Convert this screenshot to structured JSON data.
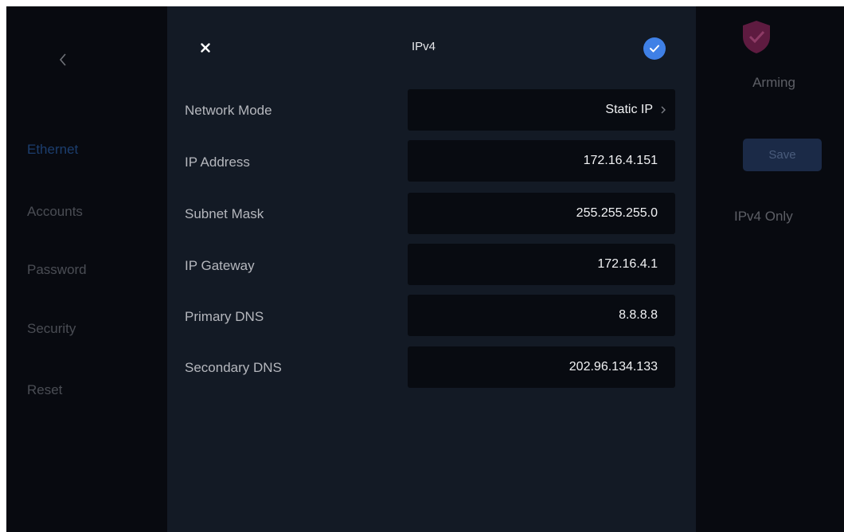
{
  "nav": {
    "items": [
      {
        "label": "Ethernet",
        "active": true
      },
      {
        "label": "Accounts"
      },
      {
        "label": "Password"
      },
      {
        "label": "Security"
      },
      {
        "label": "Reset"
      }
    ]
  },
  "right": {
    "arming_label": "Arming",
    "save_label": "Save",
    "mode_label": "IPv4 Only",
    "arming_color": "#6b1f47"
  },
  "dialog": {
    "title": "IPv4",
    "accent": "#3f80e6",
    "rows": [
      {
        "label": "Network Mode",
        "value": "Static IP",
        "has_arrow": true
      },
      {
        "label": "IP Address",
        "value": "172.16.4.151"
      },
      {
        "label": "Subnet Mask",
        "value": "255.255.255.0"
      },
      {
        "label": "IP Gateway",
        "value": "172.16.4.1"
      },
      {
        "label": "Primary DNS",
        "value": "8.8.8.8"
      },
      {
        "label": "Secondary DNS",
        "value": "202.96.134.133"
      }
    ]
  }
}
